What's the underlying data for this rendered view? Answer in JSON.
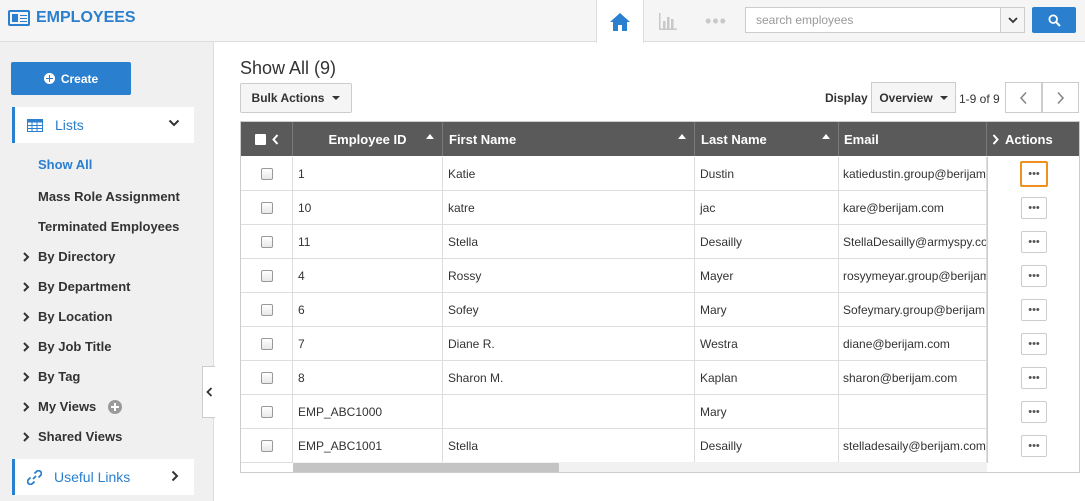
{
  "header": {
    "app_title": "EMPLOYEES",
    "home_icon": "home-icon",
    "reports_icon": "bar-chart-icon",
    "more_label": "•••",
    "search": {
      "placeholder": "search employees"
    }
  },
  "sidebar": {
    "create_label": "Create",
    "lists_label": "Lists",
    "items": [
      {
        "label": "Show All",
        "active": true
      },
      {
        "label": "Mass Role Assignment"
      },
      {
        "label": "Terminated Employees"
      }
    ],
    "groups": [
      {
        "label": "By Directory"
      },
      {
        "label": "By Department"
      },
      {
        "label": "By Location"
      },
      {
        "label": "By Job Title"
      },
      {
        "label": "By Tag"
      },
      {
        "label": "My Views"
      },
      {
        "label": "Shared Views"
      }
    ],
    "useful_links_label": "Useful Links"
  },
  "main": {
    "title": "Show All (9)",
    "bulk_actions_label": "Bulk Actions",
    "display_label": "Display",
    "display_value": "Overview",
    "page_range": "1-9 of 9"
  },
  "table": {
    "columns": [
      "Employee ID",
      "First Name",
      "Last Name",
      "Email",
      "Actions"
    ],
    "rows": [
      {
        "id": "1",
        "first": "Katie",
        "last": "Dustin",
        "email": "katiedustin.group@berijam"
      },
      {
        "id": "10",
        "first": "katre",
        "last": "jac",
        "email": "kare@berijam.com"
      },
      {
        "id": "11",
        "first": "Stella",
        "last": "Desailly",
        "email": "StellaDesailly@armyspy.co"
      },
      {
        "id": "4",
        "first": "Rossy",
        "last": "Mayer",
        "email": "rosyymeyar.group@berijam"
      },
      {
        "id": "6",
        "first": "Sofey",
        "last": "Mary",
        "email": "Sofeymary.group@berijam"
      },
      {
        "id": "7",
        "first": "Diane R.",
        "last": "Westra",
        "email": "diane@berijam.com"
      },
      {
        "id": "8",
        "first": "Sharon M.",
        "last": "Kaplan",
        "email": "sharon@berijam.com"
      },
      {
        "id": "EMP_ABC1000",
        "first": "",
        "last": "Mary",
        "email": ""
      },
      {
        "id": "EMP_ABC1001",
        "first": "Stella",
        "last": "Desailly",
        "email": "stelladesaily@berijam.com"
      }
    ],
    "action_label": "•••"
  },
  "colors": {
    "accent": "#2a7fce",
    "header_bg": "#5a5a5a",
    "focus": "#f0901e"
  }
}
